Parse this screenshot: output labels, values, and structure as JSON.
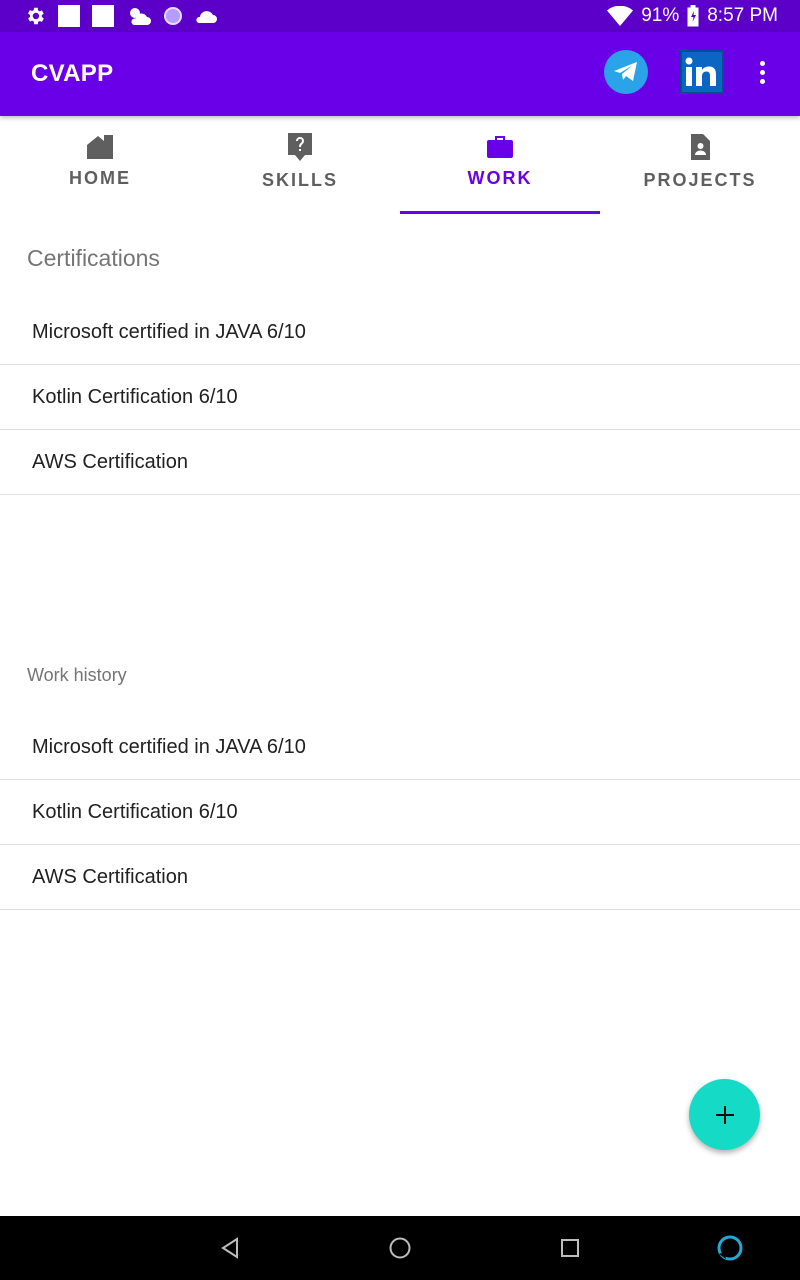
{
  "status_bar": {
    "battery": "91%",
    "time": "8:57 PM",
    "icons": [
      "gear-icon",
      "square-icon",
      "square-icon",
      "cloud-sun-icon",
      "circle-icon",
      "cloud-icon",
      "wifi-icon",
      "battery-icon"
    ]
  },
  "app_bar": {
    "title": "CVAPP",
    "actions": [
      "telegram-icon",
      "linkedin-icon",
      "more-vert-icon"
    ]
  },
  "tabs": [
    {
      "label": "HOME",
      "icon": "home-icon"
    },
    {
      "label": "SKILLS",
      "icon": "help-icon"
    },
    {
      "label": "WORK",
      "icon": "briefcase-icon",
      "active": true
    },
    {
      "label": "PROJECTS",
      "icon": "badge-document-icon"
    }
  ],
  "certifications": {
    "title": "Certifications",
    "items": [
      "Microsoft certified in JAVA 6/10",
      "Kotlin Certification 6/10",
      "AWS Certification"
    ]
  },
  "work_history": {
    "title": "Work history",
    "items": [
      "Microsoft certified in JAVA 6/10",
      "Kotlin Certification 6/10",
      "AWS Certification"
    ]
  },
  "fab": {
    "icon": "add-icon"
  },
  "colors": {
    "status_bar": "#5c00c9",
    "app_bar": "#6a00e8",
    "accent": "#6a00e8",
    "fab": "#15dbc6"
  }
}
